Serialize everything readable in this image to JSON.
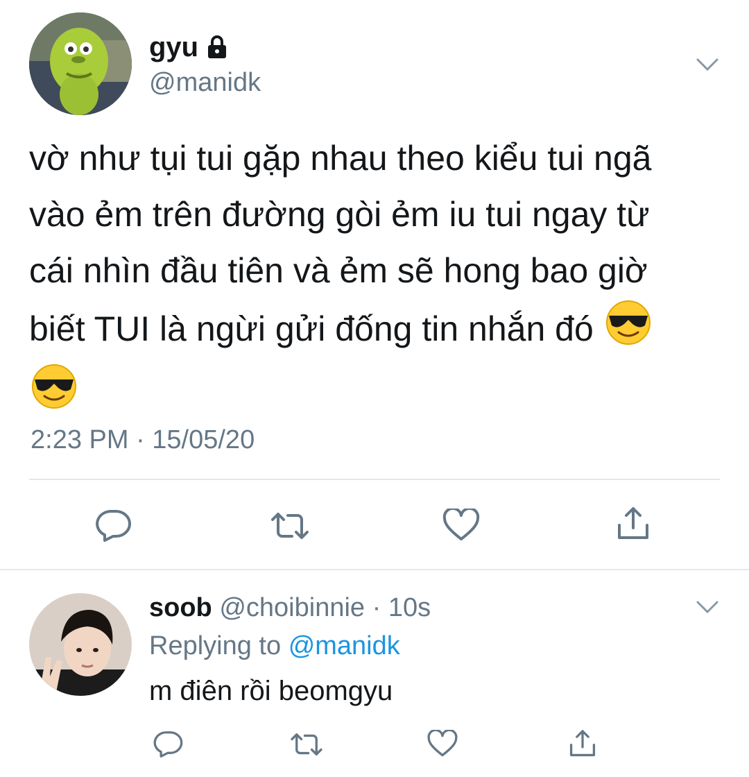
{
  "main_tweet": {
    "display_name": "gyu",
    "handle": "@manidk",
    "protected_icon": "lock-icon",
    "text": "vờ như tụi tui gặp nhau theo kiểu tui ngã vào ẻm trên đường gòi ẻm iu tui ngay từ cái nhìn đầu tiên và ẻm sẽ hong bao giờ biết TUI là ngừi gửi đống tin nhắn đó",
    "emojis": [
      "smiling-face-with-sunglasses",
      "smiling-face-with-sunglasses"
    ],
    "timestamp": "2:23 PM · 15/05/20",
    "actions": [
      "reply-icon",
      "retweet-icon",
      "like-icon",
      "share-icon"
    ]
  },
  "reply_tweet": {
    "display_name": "soob",
    "handle": "@choibinnie",
    "time": "· 10s",
    "replying_prefix": "Replying to",
    "replying_handle": "@manidk",
    "text": "m điên rồi beomgyu",
    "actions": [
      "reply-icon",
      "retweet-icon",
      "like-icon",
      "share-icon"
    ]
  },
  "colors": {
    "text": "#14171a",
    "secondary": "#657786",
    "link": "#1b95e0",
    "divider": "#e1e8ed"
  }
}
